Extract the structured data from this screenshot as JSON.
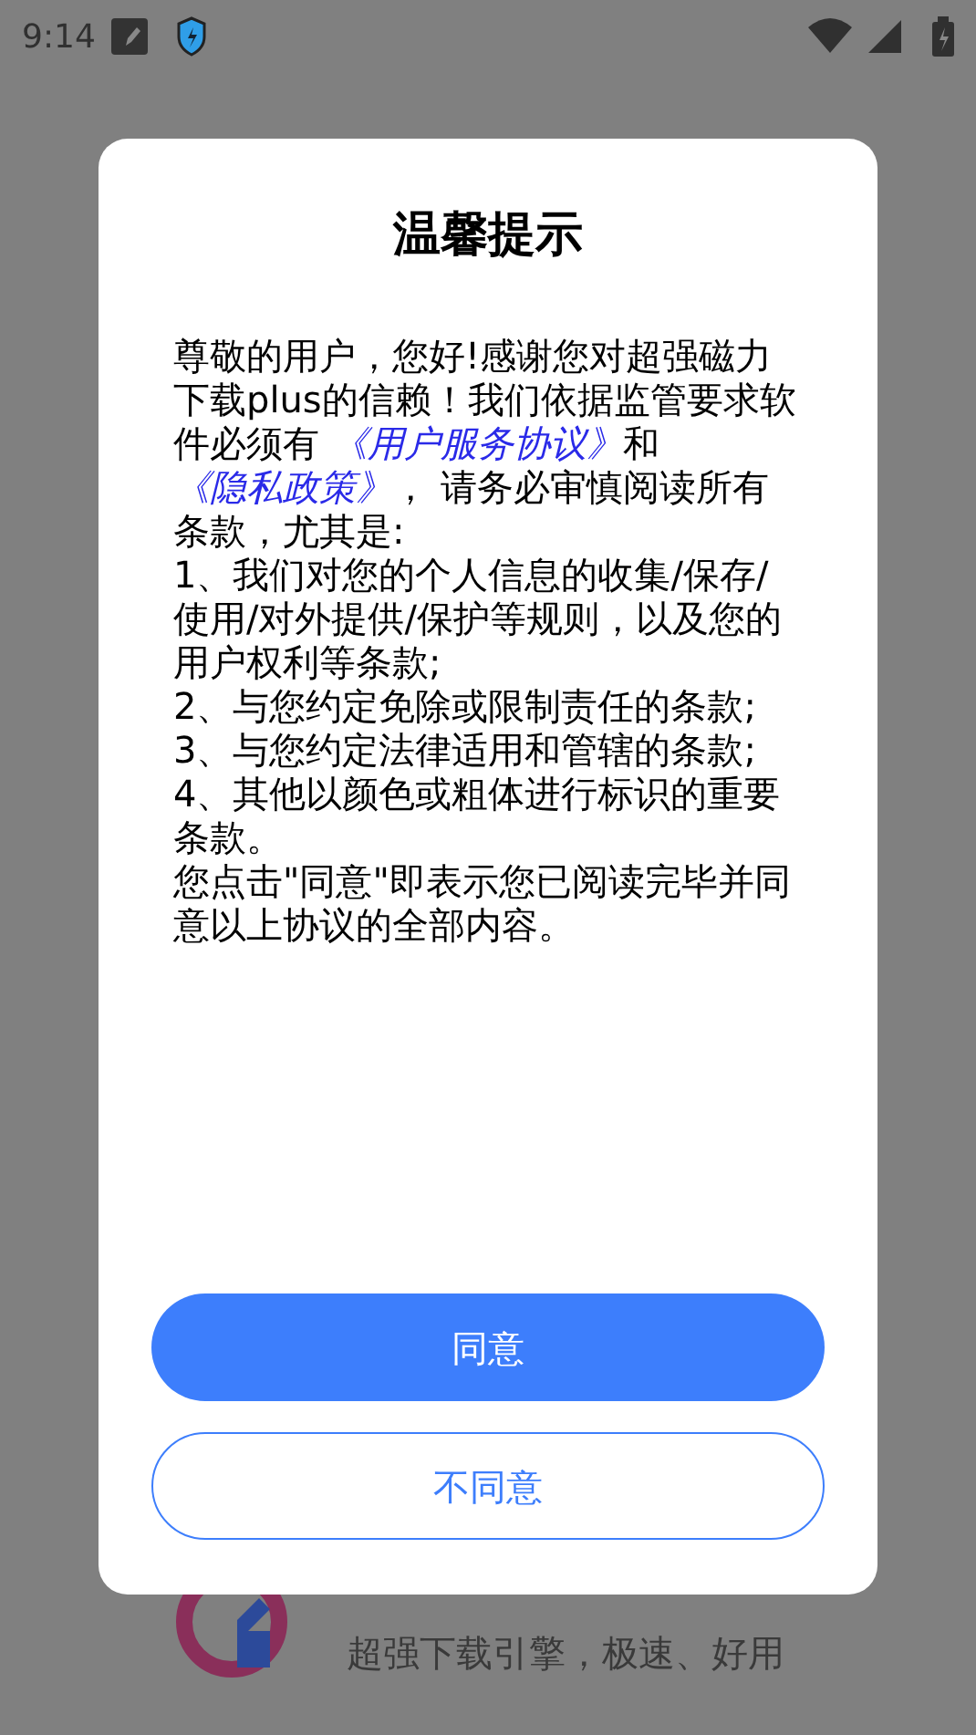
{
  "status_bar": {
    "time": "9:14"
  },
  "app": {
    "tagline": "超强下载引擎，极速、好用"
  },
  "dialog": {
    "title": "温馨提示",
    "intro": [
      {
        "kind": "text",
        "text": "尊敬的用户，您好!感谢您对超强磁力下载plus的信赖！我们依据监管要求软件必须有 "
      },
      {
        "kind": "link",
        "text": "《用户服务协议》"
      },
      {
        "kind": "text",
        "text": "和 "
      },
      {
        "kind": "link",
        "text": "《隐私政策》"
      },
      {
        "kind": "text",
        "text": "， 请务必审慎阅读所有条款，尤其是:"
      }
    ],
    "items": [
      "1、我们对您的个人信息的收集/保存/使用/对外提供/保护等规则，以及您的用户权利等条款;",
      "2、与您约定免除或限制责任的条款;",
      "3、与您约定法律适用和管辖的条款;",
      "4、其他以颜色或粗体进行标识的重要条款。"
    ],
    "closing": "您点击\"同意\"即表示您已阅读完毕并同意以上协议的全部内容。",
    "buttons": [
      {
        "kind": "primary",
        "label": "同意"
      },
      {
        "kind": "outline",
        "label": "不同意"
      }
    ]
  }
}
